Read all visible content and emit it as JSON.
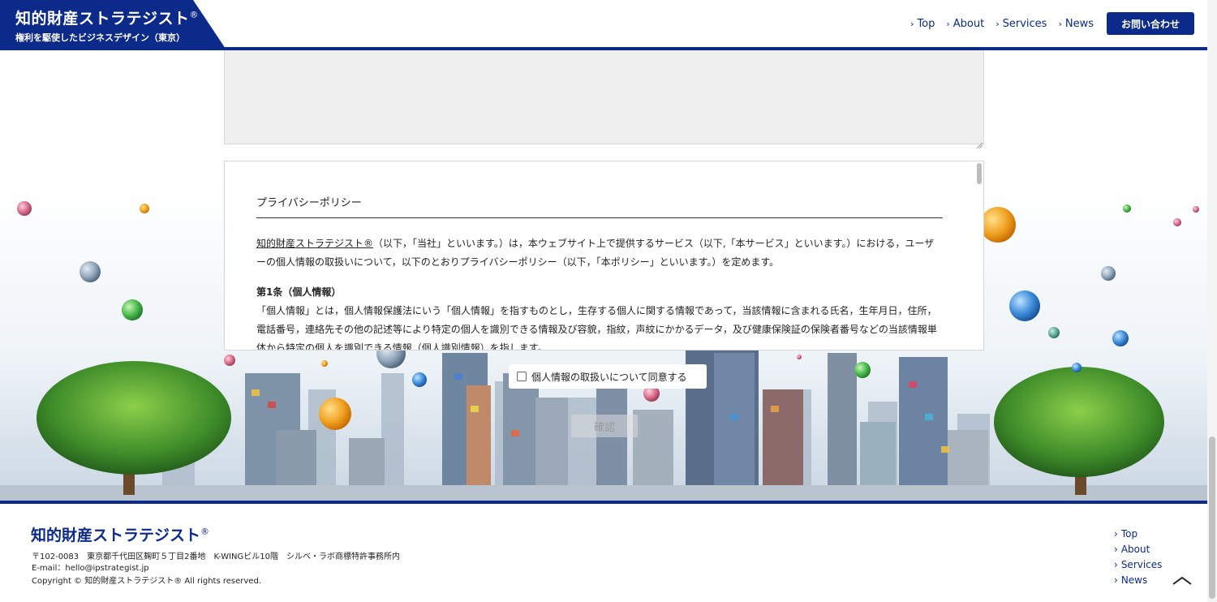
{
  "header": {
    "brand_title": "知的財産ストラテジスト",
    "brand_mark": "®",
    "brand_subtitle": "権利を駆使したビジネスデザイン（東京）",
    "nav": [
      {
        "label": "Top"
      },
      {
        "label": "About"
      },
      {
        "label": "Services"
      },
      {
        "label": "News"
      }
    ],
    "contact_label": "お問い合わせ"
  },
  "form": {
    "message_value": "",
    "policy": {
      "title": "プライバシーポリシー",
      "intro_link": "知的財産ストラテジスト®",
      "intro_rest": "（以下，「当社」といいます。）は，本ウェブサイト上で提供するサービス（以下,「本サービス」といいます。）における，ユーザーの個人情報の取扱いについて，以下のとおりプライバシーポリシー（以下，「本ポリシー」といいます。）を定めます。",
      "article1_heading": "第1条（個人情報）",
      "article1_body": "「個人情報」とは，個人情報保護法にいう「個人情報」を指すものとし，生存する個人に関する情報であって，当該情報に含まれる氏名，生年月日，住所，電話番号，連絡先その他の記述等により特定の個人を識別できる情報及び容貌，指紋，声紋にかかるデータ，及び健康保険証の保険者番号などの当該情報単体から特定の個人を識別できる情報（個人識別情報）を指します。"
    },
    "agree_label": "個人情報の取扱いについて同意する",
    "agree_checked": false,
    "confirm_label": "確認"
  },
  "footer": {
    "title": "知的財産ストラテジスト",
    "mark": "®",
    "address": "〒102-0083　東京都千代田区麹町５丁目2番地　K-WINGビル10階　シルベ・ラボ商標特許事務所内",
    "email": "E-mail：hello@ipstrategist.jp",
    "copyright": "Copyright © 知的財産ストラテジスト® All rights reserved.",
    "nav": [
      {
        "label": "Top"
      },
      {
        "label": "About"
      },
      {
        "label": "Services"
      },
      {
        "label": "News"
      }
    ]
  },
  "colors": {
    "brand": "#0b2a8a",
    "textarea_bg": "#efefef"
  },
  "icons": {
    "nav_chevron": "chevron-right-icon",
    "to_top": "chevron-up-icon"
  }
}
